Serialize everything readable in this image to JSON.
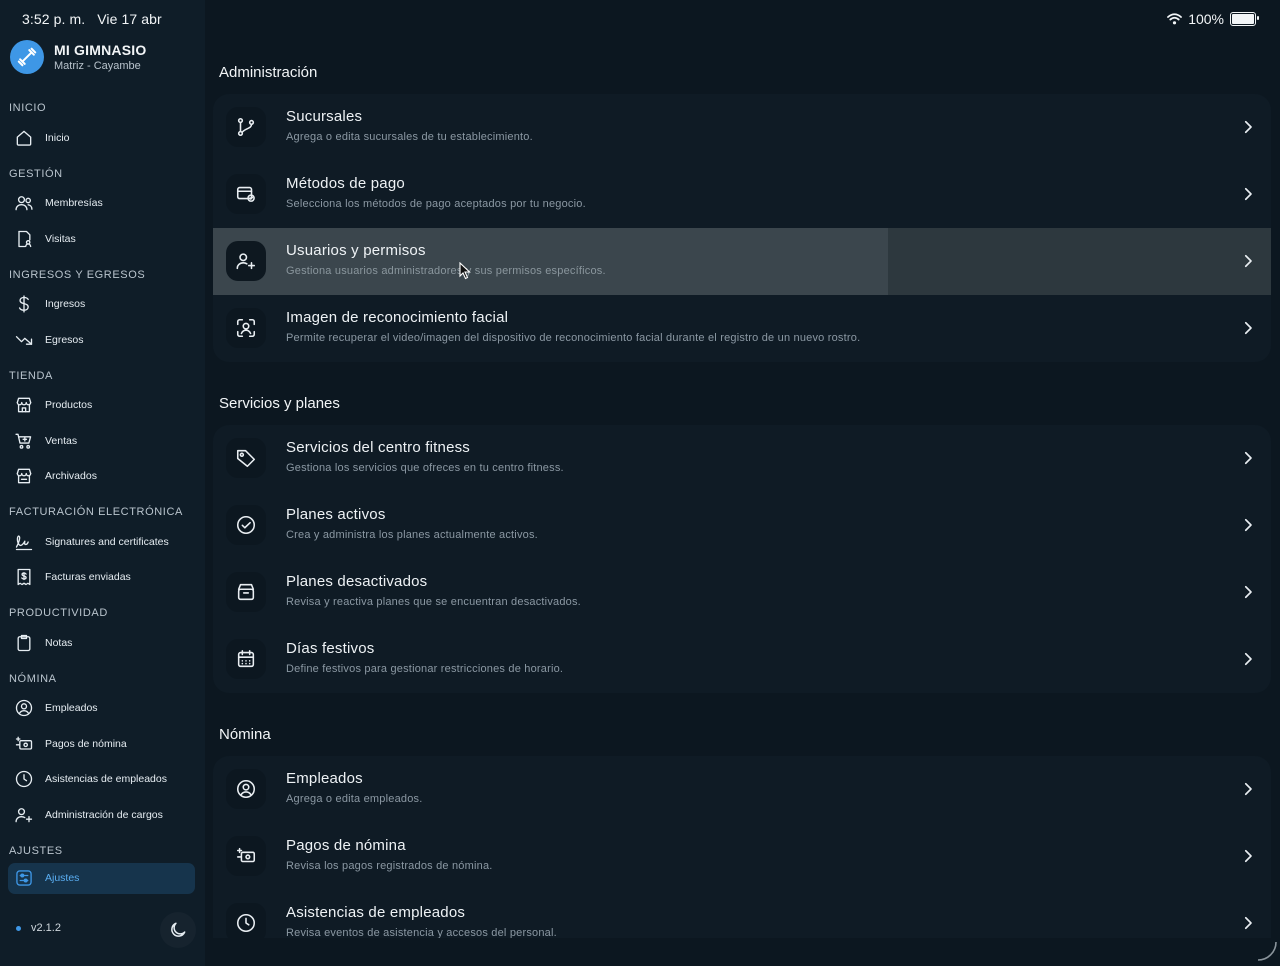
{
  "status": {
    "time": "3:52 p. m.",
    "date": "Vie 17 abr",
    "battery": "100%",
    "battery_level": 1.0
  },
  "brand": {
    "name": "MI GIMNASIO",
    "branch": "Matriz - Cayambe"
  },
  "sidebar": {
    "sections": [
      {
        "title": "INICIO",
        "items": [
          {
            "label": "Inicio",
            "icon": "home-icon"
          }
        ]
      },
      {
        "title": "GESTIÓN",
        "items": [
          {
            "label": "Membresías",
            "icon": "users-icon"
          },
          {
            "label": "Visitas",
            "icon": "visit-icon"
          }
        ]
      },
      {
        "title": "INGRESOS Y EGRESOS",
        "items": [
          {
            "label": "Ingresos",
            "icon": "dollar-icon"
          },
          {
            "label": "Egresos",
            "icon": "trend-down-icon"
          }
        ]
      },
      {
        "title": "TIENDA",
        "items": [
          {
            "label": "Productos",
            "icon": "store-icon"
          },
          {
            "label": "Ventas",
            "icon": "cart-icon"
          },
          {
            "label": "Archivados",
            "icon": "archive-store-icon"
          }
        ]
      },
      {
        "title": "FACTURACIÓN ELECTRÓNICA",
        "items": [
          {
            "label": "Signatures and certificates",
            "icon": "signature-icon"
          },
          {
            "label": "Facturas enviadas",
            "icon": "receipt-icon"
          }
        ]
      },
      {
        "title": "PRODUCTIVIDAD",
        "items": [
          {
            "label": "Notas",
            "icon": "clipboard-icon"
          }
        ]
      },
      {
        "title": "NÓMINA",
        "items": [
          {
            "label": "Empleados",
            "icon": "user-circle-icon"
          },
          {
            "label": "Pagos de nómina",
            "icon": "payment-icon"
          },
          {
            "label": "Asistencias de empleados",
            "icon": "clock-icon"
          },
          {
            "label": "Administración de cargos",
            "icon": "user-plus-icon"
          }
        ]
      },
      {
        "title": "AJUSTES",
        "items": [
          {
            "label": "Ajustes",
            "icon": "settings-icon",
            "active": true
          }
        ]
      }
    ]
  },
  "footer": {
    "version": "v2.1.2"
  },
  "main": {
    "groups": [
      {
        "title": "Administración",
        "rows": [
          {
            "title": "Sucursales",
            "desc": "Agrega o edita sucursales de tu establecimiento."
          },
          {
            "title": "Métodos de pago",
            "desc": "Selecciona los métodos de pago aceptados por tu negocio."
          },
          {
            "title": "Usuarios y permisos",
            "desc": "Gestiona usuarios administradores y sus permisos específicos."
          },
          {
            "title": "Imagen de reconocimiento facial",
            "desc": "Permite recuperar el video/imagen del dispositivo de reconocimiento facial durante el registro de un nuevo rostro."
          }
        ]
      },
      {
        "title": "Servicios y planes",
        "rows": [
          {
            "title": "Servicios del centro fitness",
            "desc": "Gestiona los servicios que ofreces en tu centro fitness."
          },
          {
            "title": "Planes activos",
            "desc": "Crea y administra los planes actualmente activos."
          },
          {
            "title": "Planes desactivados",
            "desc": "Revisa y reactiva planes que se encuentran desactivados."
          },
          {
            "title": "Días festivos",
            "desc": "Define festivos para gestionar restricciones de horario."
          }
        ]
      },
      {
        "title": "Nómina",
        "rows": [
          {
            "title": "Empleados",
            "desc": "Agrega o edita empleados."
          },
          {
            "title": "Pagos de nómina",
            "desc": "Revisa los pagos registrados de nómina."
          },
          {
            "title": "Asistencias de empleados",
            "desc": "Revisa eventos de asistencia y accesos del personal."
          }
        ]
      }
    ]
  },
  "colors": {
    "accent": "#3e97e6",
    "background": "#0c1720",
    "card": "#0f1b25",
    "active_nav": "#16344c"
  }
}
